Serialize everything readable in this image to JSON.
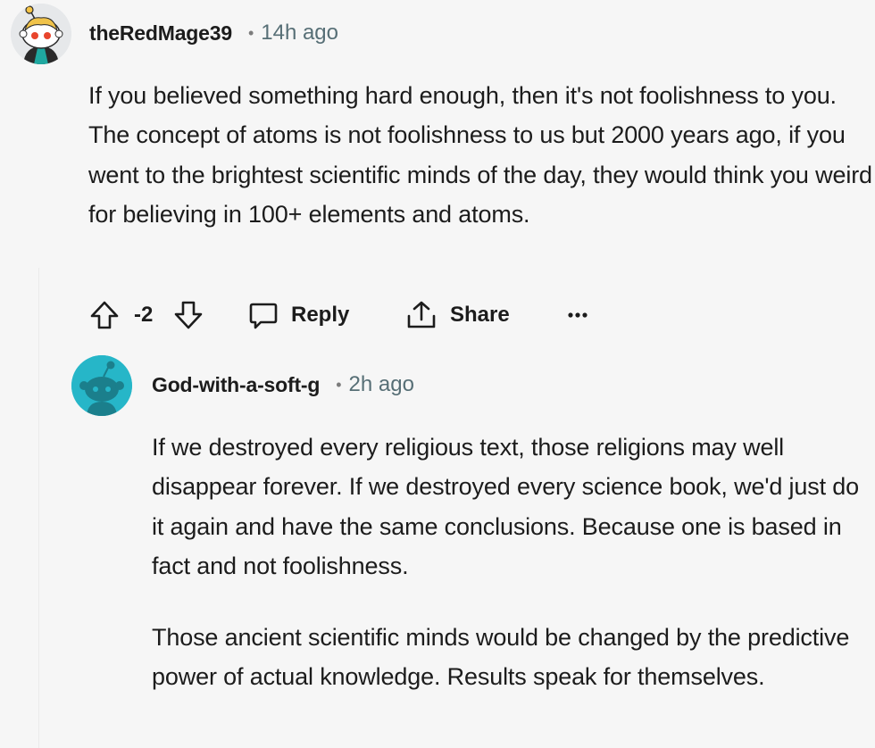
{
  "comments": [
    {
      "username": "theRedMage39",
      "separator": "•",
      "timestamp": "14h ago",
      "paragraphs": [
        "If you believed something hard enough, then it's not foolishness to you. The concept of atoms is not foolishness to us but 2000 years ago, if you went to the brightest scientific minds of the day, they would think you weird for believing in 100+ elements and atoms."
      ],
      "votes": "-2",
      "reply_label": "Reply",
      "share_label": "Share",
      "more_label": "•••"
    },
    {
      "username": "God-with-a-soft-g",
      "separator": "•",
      "timestamp": "2h ago",
      "paragraphs": [
        "If we destroyed every religious text, those religions may well disappear forever. If we destroyed every science book, we'd just do it again and have the same conclusions. Because one is based in fact and not foolishness.",
        "Those ancient scientific minds would be changed by the predictive power of actual knowledge. Results speak for themselves."
      ]
    }
  ],
  "colors": {
    "background": "#f6f6f6",
    "text": "#1c1c1c",
    "meta": "#576f76",
    "avatar_teal": "#26b6c8"
  },
  "icons": [
    "upvote-icon",
    "downvote-icon",
    "comment-bubble-icon",
    "share-icon",
    "more-options-icon",
    "snoo-avatar-icon"
  ]
}
